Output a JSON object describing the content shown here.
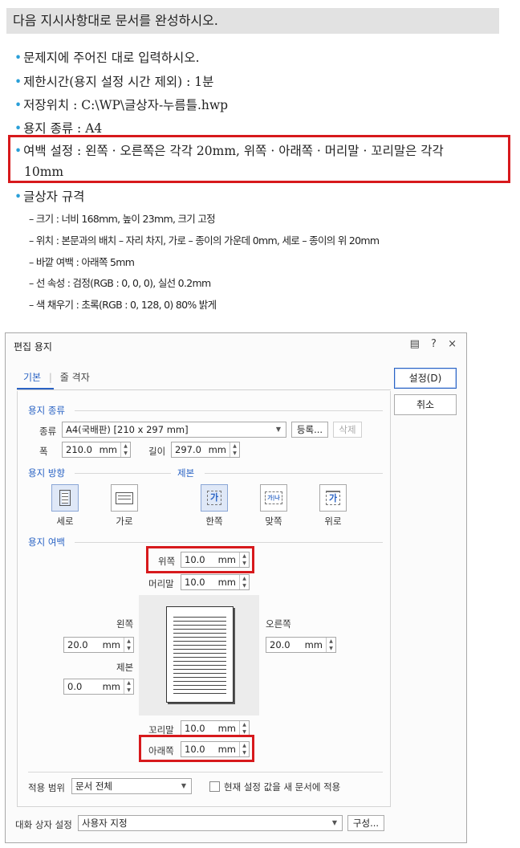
{
  "instructions": {
    "heading": "다음 지시사항대로 문서를 완성하시오.",
    "bullet": "•",
    "items": [
      "문제지에 주어진 대로 입력하시오.",
      "제한시간(용지 설정 시간 제외) : 1분",
      "저장위치 : C:\\WP\\글상자-누름틀.hwp",
      "용지 종류 : A4",
      "여백 설정 : 왼쪽 · 오른쪽은 각각 20mm, 위쪽 · 아래쪽 · 머리말 · 꼬리말은 각각",
      "10mm",
      "글상자 규격"
    ],
    "specs": [
      "– 크기 : 너비 168mm, 높이 23mm, 크기 고정",
      "– 위치 : 본문과의 배치 – 자리 차지, 가로 – 종이의 가운데 0mm, 세로 – 종이의 위 20mm",
      "– 바깥 여백 : 아래쪽 5mm",
      "– 선 속성 : 검정(RGB : 0, 0, 0), 실선 0.2mm",
      "– 색 채우기 : 초록(RGB : 0, 128, 0) 80% 밝게"
    ]
  },
  "dialog": {
    "title": "편집 용지",
    "controls": {
      "help": "?",
      "close": "×",
      "menu_icon": "memo-icon"
    },
    "tabs": [
      {
        "label": "기본"
      },
      {
        "label": "줄 격자"
      }
    ],
    "tab_separator": "|",
    "buttons": {
      "ok": "설정(D)",
      "cancel": "취소"
    },
    "paper_type": {
      "section": "용지 종류",
      "kind_label": "종류",
      "kind_value": "A4(국배판) [210 x 297 mm]",
      "register": "등록...",
      "delete": "삭제",
      "width_label": "폭",
      "width_value": "210.0",
      "length_label": "길이",
      "length_value": "297.0",
      "unit": "mm"
    },
    "orientation": {
      "section": "용지 방향",
      "portrait": "세로",
      "landscape": "가로"
    },
    "binding": {
      "section": "제본",
      "single": "한쪽",
      "facing": "맞쪽",
      "top": "위로"
    },
    "margins": {
      "section": "용지 여백",
      "top_label": "위쪽",
      "top_value": "10.0",
      "header_label": "머리말",
      "header_value": "10.0",
      "left_label": "왼쪽",
      "left_value": "20.0",
      "right_label": "오른쪽",
      "right_value": "20.0",
      "gutter_label": "제본",
      "gutter_value": "0.0",
      "footer_label": "꼬리말",
      "footer_value": "10.0",
      "bottom_label": "아래쪽",
      "bottom_value": "10.0",
      "unit": "mm"
    },
    "apply": {
      "scope_label": "적용 범위",
      "scope_value": "문서 전체",
      "checkbox_label": "현재 설정 값을 새 문서에 적용"
    },
    "dialog_setting": {
      "label": "대화 상자 설정",
      "value": "사용자 지정",
      "config_button": "구성..."
    },
    "colors": {
      "accent": "#2a63c4",
      "highlight_box": "#d7191c",
      "bullet": "#2a9fd8"
    }
  }
}
